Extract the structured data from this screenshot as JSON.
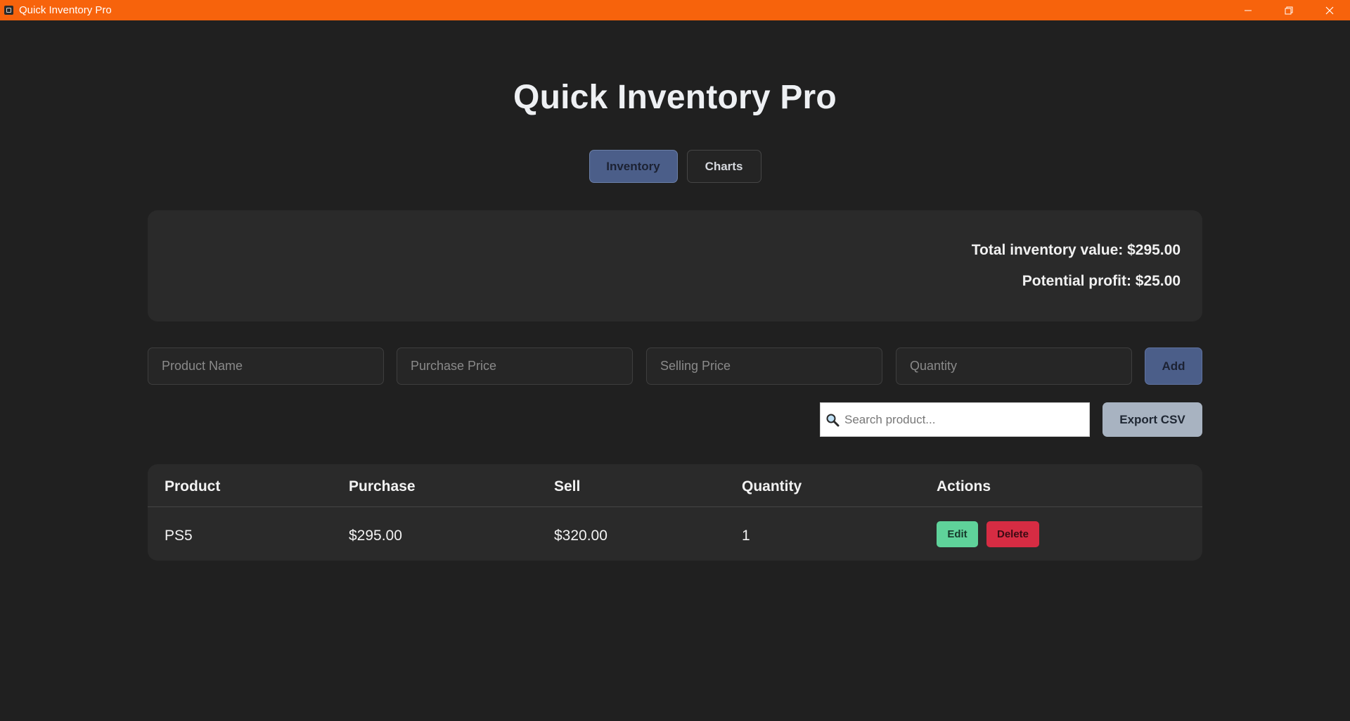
{
  "window": {
    "title": "Quick Inventory Pro",
    "accent_color": "#f7630c",
    "controls": [
      "minimize-icon",
      "restore-icon",
      "close-icon"
    ]
  },
  "app": {
    "title": "Quick Inventory Pro"
  },
  "tabs": [
    {
      "label": "Inventory",
      "active": true
    },
    {
      "label": "Charts",
      "active": false
    }
  ],
  "summary": {
    "total_value": "Total inventory value: $295.00",
    "potential_profit": "Potential profit: $25.00"
  },
  "form": {
    "product_name_placeholder": "Product Name",
    "purchase_price_placeholder": "Purchase Price",
    "selling_price_placeholder": "Selling Price",
    "quantity_placeholder": "Quantity",
    "add_label": "Add"
  },
  "search": {
    "icon": "magnifier-icon",
    "placeholder": "Search product..."
  },
  "export_label": "Export CSV",
  "table": {
    "headers": [
      "Product",
      "Purchase",
      "Sell",
      "Quantity",
      "Actions"
    ],
    "rows": [
      {
        "product": "PS5",
        "purchase": "$295.00",
        "sell": "$320.00",
        "quantity": "1",
        "edit_label": "Edit",
        "delete_label": "Delete"
      }
    ]
  },
  "colors": {
    "background": "#202020",
    "primary_button": "#4b5e89",
    "edit": "#5fd29a",
    "delete": "#d62c43",
    "export": "#a8b3c1"
  }
}
